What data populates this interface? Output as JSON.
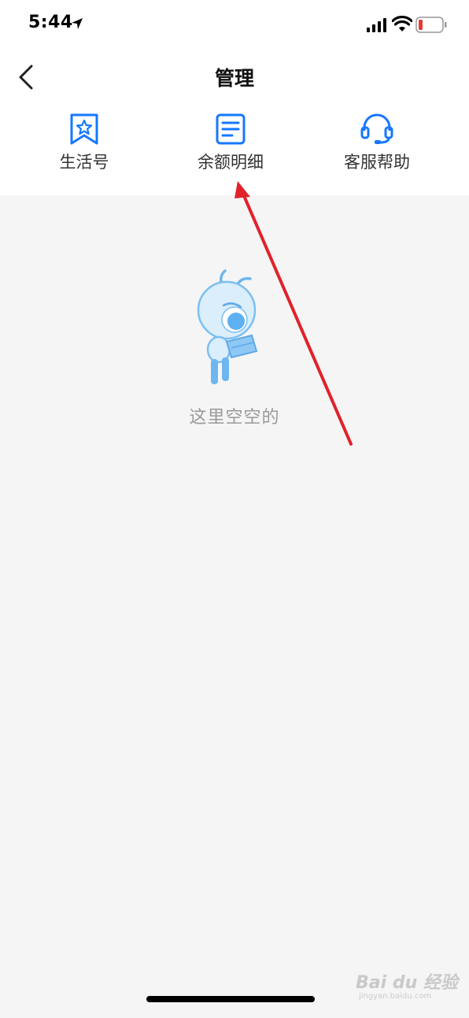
{
  "status_bar": {
    "time": "5:44",
    "icons": [
      "location-arrow-icon",
      "cellular-signal-icon",
      "wifi-icon",
      "battery-low-icon"
    ],
    "battery_color": "#e53935"
  },
  "nav": {
    "title": "管理",
    "back_icon": "chevron-left-icon"
  },
  "quick_actions": [
    {
      "label": "生活号",
      "icon": "bookmark-star-icon"
    },
    {
      "label": "余额明细",
      "icon": "document-list-icon"
    },
    {
      "label": "客服帮助",
      "icon": "headset-icon"
    }
  ],
  "empty_state": {
    "illustration": "ant-mascot-reading-icon",
    "text": "这里空空的"
  },
  "annotation": {
    "type": "red-arrow",
    "color": "#e0222b"
  },
  "watermark": {
    "brand": "Bai du 经验",
    "url": "jingyan.baidu.com"
  },
  "colors": {
    "accent": "#1677ff",
    "background": "#f5f5f5"
  }
}
